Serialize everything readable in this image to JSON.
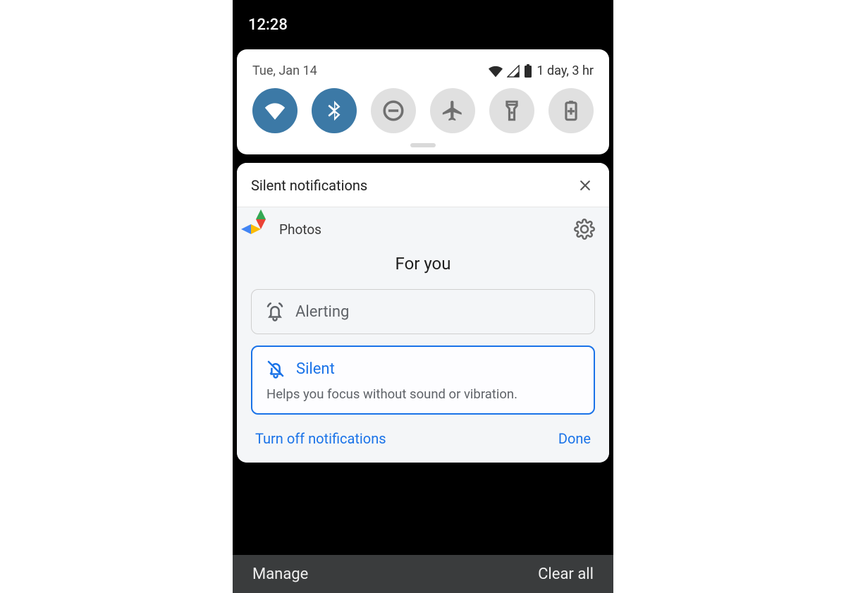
{
  "status": {
    "time": "12:28"
  },
  "qs": {
    "date": "Tue, Jan 14",
    "battery_text": "1 day, 3 hr",
    "tiles": [
      {
        "name": "wifi",
        "active": true
      },
      {
        "name": "bluetooth",
        "active": true
      },
      {
        "name": "dnd",
        "active": false
      },
      {
        "name": "airplane",
        "active": false
      },
      {
        "name": "flashlight",
        "active": false
      },
      {
        "name": "battery-saver",
        "active": false
      }
    ]
  },
  "silent_section": {
    "title": "Silent notifications"
  },
  "notification": {
    "app_name": "Photos",
    "heading": "For you",
    "options": {
      "alerting": {
        "label": "Alerting"
      },
      "silent": {
        "label": "Silent",
        "description": "Helps you focus without sound or vibration."
      }
    },
    "actions": {
      "turn_off": "Turn off notifications",
      "done": "Done"
    }
  },
  "footer": {
    "manage": "Manage",
    "clear_all": "Clear all"
  }
}
